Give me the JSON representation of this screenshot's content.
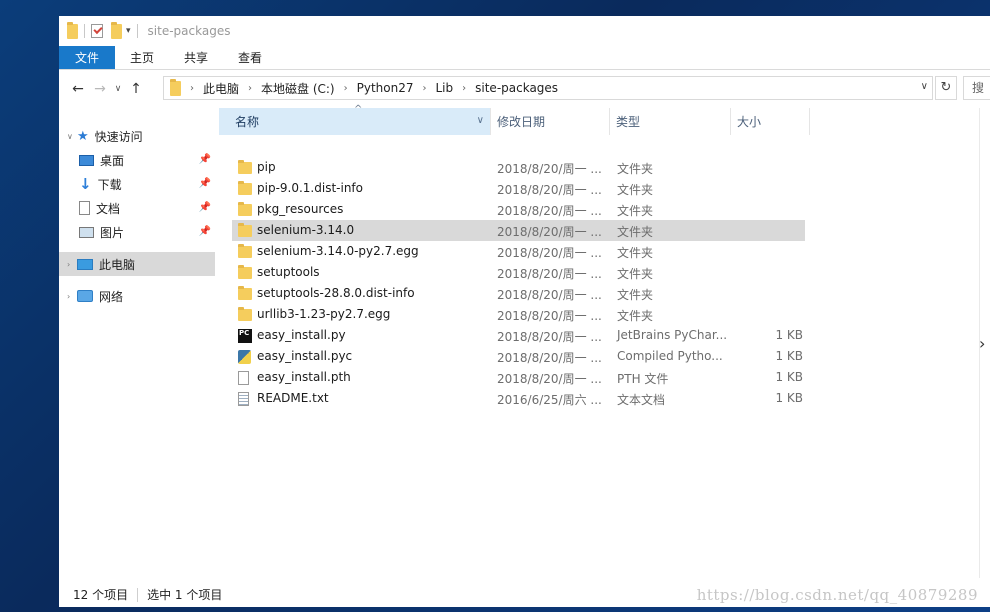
{
  "window": {
    "title": "site-packages"
  },
  "ribbon": {
    "tabs": [
      {
        "label": "文件"
      },
      {
        "label": "主页"
      },
      {
        "label": "共享"
      },
      {
        "label": "查看"
      }
    ]
  },
  "address": {
    "crumbs": [
      "此电脑",
      "本地磁盘 (C:)",
      "Python27",
      "Lib",
      "site-packages"
    ],
    "search_placeholder": "搜"
  },
  "nav": {
    "quick_access": "快速访问",
    "items": [
      {
        "label": "桌面",
        "icon": "desktop-icon"
      },
      {
        "label": "下载",
        "icon": "download-icon"
      },
      {
        "label": "文档",
        "icon": "document-icon"
      },
      {
        "label": "图片",
        "icon": "picture-icon"
      }
    ],
    "this_pc": "此电脑",
    "network": "网络"
  },
  "columns": {
    "name": "名称",
    "date": "修改日期",
    "type": "类型",
    "size": "大小"
  },
  "files": [
    {
      "name": "pip",
      "date": "2018/8/20/周一 ...",
      "type": "文件夹",
      "size": "",
      "icon": "folder"
    },
    {
      "name": "pip-9.0.1.dist-info",
      "date": "2018/8/20/周一 ...",
      "type": "文件夹",
      "size": "",
      "icon": "folder"
    },
    {
      "name": "pkg_resources",
      "date": "2018/8/20/周一 ...",
      "type": "文件夹",
      "size": "",
      "icon": "folder"
    },
    {
      "name": "selenium-3.14.0",
      "date": "2018/8/20/周一 ...",
      "type": "文件夹",
      "size": "",
      "icon": "folder",
      "selected": true
    },
    {
      "name": "selenium-3.14.0-py2.7.egg",
      "date": "2018/8/20/周一 ...",
      "type": "文件夹",
      "size": "",
      "icon": "folder"
    },
    {
      "name": "setuptools",
      "date": "2018/8/20/周一 ...",
      "type": "文件夹",
      "size": "",
      "icon": "folder"
    },
    {
      "name": "setuptools-28.8.0.dist-info",
      "date": "2018/8/20/周一 ...",
      "type": "文件夹",
      "size": "",
      "icon": "folder"
    },
    {
      "name": "urllib3-1.23-py2.7.egg",
      "date": "2018/8/20/周一 ...",
      "type": "文件夹",
      "size": "",
      "icon": "folder"
    },
    {
      "name": "easy_install.py",
      "date": "2018/8/20/周一 ...",
      "type": "JetBrains PyChar...",
      "size": "1 KB",
      "icon": "pycharm"
    },
    {
      "name": "easy_install.pyc",
      "date": "2018/8/20/周一 ...",
      "type": "Compiled Pytho...",
      "size": "1 KB",
      "icon": "pyc"
    },
    {
      "name": "easy_install.pth",
      "date": "2018/8/20/周一 ...",
      "type": "PTH 文件",
      "size": "1 KB",
      "icon": "file"
    },
    {
      "name": "README.txt",
      "date": "2016/6/25/周六 ...",
      "type": "文本文档",
      "size": "1 KB",
      "icon": "txt"
    }
  ],
  "status": {
    "count": "12 个项目",
    "selected": "选中 1 个项目"
  },
  "watermark": "https://blog.csdn.net/qq_40879289"
}
